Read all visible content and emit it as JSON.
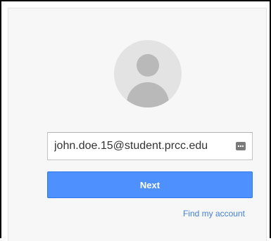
{
  "signin": {
    "avatar_icon": "default-user-avatar-icon",
    "email_value": "john.doe.15@student.prcc.edu",
    "password_manager_icon": "keyboard-key-icon",
    "next_label": "Next",
    "find_account_label": "Find my account"
  },
  "colors": {
    "accent": "#4d90fe",
    "link": "#427fed",
    "card_background": "#f7f7f7"
  }
}
